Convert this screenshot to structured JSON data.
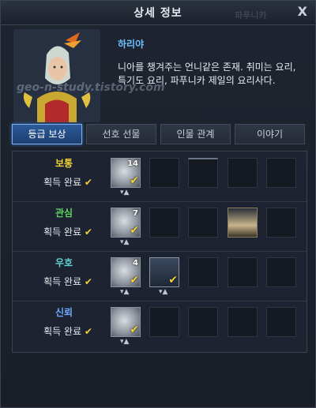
{
  "window": {
    "title": "상세 정보",
    "ghost_name": "파푸니카",
    "close_label": "X"
  },
  "npc": {
    "name": "하리야",
    "description": "니아를 챙겨주는 언니같은 존재. 취미는 요리, 특기도 요리, 파푸니카 제일의 요리사다."
  },
  "watermark": "geo-n-study.tistory.com",
  "tabs": [
    {
      "label": "등급 보상",
      "active": true
    },
    {
      "label": "선호 선물",
      "active": false
    },
    {
      "label": "인물 관계",
      "active": false
    },
    {
      "label": "이야기",
      "active": false
    }
  ],
  "rows": [
    {
      "tier": "보통",
      "tier_color": "#f1d23a",
      "status": "획득 완료",
      "items": [
        {
          "icon": "coin-icon",
          "count": "14",
          "acquired": true
        }
      ]
    },
    {
      "tier": "관심",
      "tier_color": "#5fd35f",
      "status": "획득 완료",
      "items": [
        {
          "icon": "coin-icon",
          "count": "7",
          "acquired": true
        }
      ]
    },
    {
      "tier": "우호",
      "tier_color": "#5fd3d3",
      "status": "획득 완료",
      "items": [
        {
          "icon": "coin-icon",
          "count": "4",
          "acquired": true
        },
        {
          "icon": "card-icon",
          "count": "",
          "acquired": true
        }
      ]
    },
    {
      "tier": "신뢰",
      "tier_color": "#6fa8ff",
      "status": "획득 완료",
      "items": [
        {
          "icon": "pouch-icon",
          "count": "",
          "acquired": true
        }
      ]
    }
  ],
  "colors": {
    "accent": "#2c5a9a",
    "check": "#f1d23a",
    "name": "#6fbfff"
  }
}
